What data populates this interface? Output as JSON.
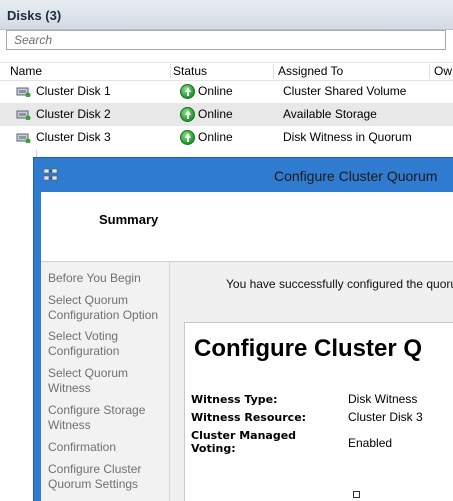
{
  "disks": {
    "title": "Disks (3)",
    "search_placeholder": "Search",
    "columns": [
      "Name",
      "Status",
      "Assigned To",
      "Ow"
    ],
    "rows": [
      {
        "name": "Cluster Disk 1",
        "status": "Online",
        "assigned_to": "Cluster Shared Volume"
      },
      {
        "name": "Cluster Disk 2",
        "status": "Online",
        "assigned_to": "Available Storage"
      },
      {
        "name": "Cluster Disk 3",
        "status": "Online",
        "assigned_to": "Disk Witness in Quorum"
      }
    ]
  },
  "wizard": {
    "title": "Configure Cluster Quorum",
    "heading": "Summary",
    "nav": [
      "Before You Begin",
      "Select Quorum Configuration Option",
      "Select Voting Configuration",
      "Select Quorum Witness",
      "Configure Storage Witness",
      "Confirmation",
      "Configure Cluster Quorum Settings"
    ],
    "success_message": "You have successfully configured the quorum",
    "report": {
      "title": "Configure Cluster Q",
      "fields": [
        {
          "label": "Witness Type:",
          "value": "Disk Witness"
        },
        {
          "label": "Witness Resource:",
          "value": "Cluster Disk 3"
        },
        {
          "label": "Cluster Managed Voting:",
          "value": "Enabled"
        }
      ]
    }
  },
  "colors": {
    "title_bar": "#2f7bd0",
    "alt_row": "#e8e8e8",
    "status_green": "#1d9a2b"
  },
  "icons": {
    "disk": "disk-icon",
    "status": "online-status-icon",
    "wizard_app": "cluster-app-icon"
  }
}
